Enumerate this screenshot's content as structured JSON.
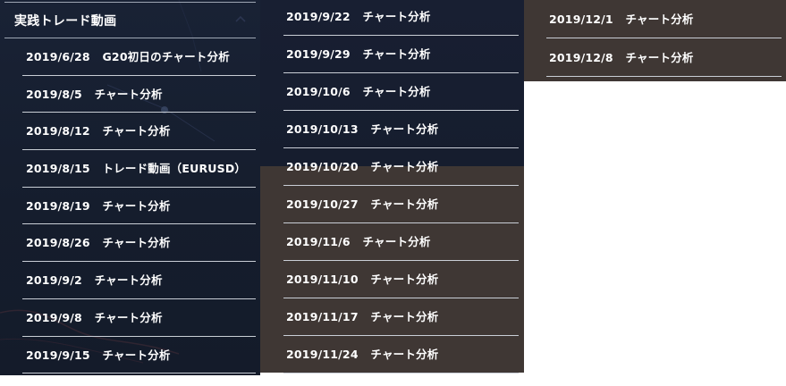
{
  "menu": {
    "title": "実践トレード動画",
    "caret_icon": "chevron-up-icon"
  },
  "columns": [
    {
      "items": [
        {
          "label": "2019/6/28   G20初日のチャート分析"
        },
        {
          "label": "2019/8/5   チャート分析"
        },
        {
          "label": "2019/8/12   チャート分析"
        },
        {
          "label": "2019/8/15   トレード動画（EURUSD）"
        },
        {
          "label": "2019/8/19   チャート分析"
        },
        {
          "label": "2019/8/26   チャート分析"
        },
        {
          "label": "2019/9/2   チャート分析"
        },
        {
          "label": "2019/9/8   チャート分析"
        },
        {
          "label": "2019/9/15   チャート分析"
        }
      ]
    },
    {
      "items": [
        {
          "label": "2019/9/22   チャート分析"
        },
        {
          "label": "2019/9/29   チャート分析"
        },
        {
          "label": "2019/10/6   チャート分析"
        },
        {
          "label": "2019/10/13   チャート分析"
        },
        {
          "label": "2019/10/20   チャート分析"
        },
        {
          "label": "2019/10/27   チャート分析"
        },
        {
          "label": "2019/11/6   チャート分析"
        },
        {
          "label": "2019/11/10   チャート分析"
        },
        {
          "label": "2019/11/17   チャート分析"
        },
        {
          "label": "2019/11/24   チャート分析"
        }
      ]
    },
    {
      "items": [
        {
          "label": "2019/12/1   チャート分析"
        },
        {
          "label": "2019/12/8   チャート分析"
        }
      ]
    }
  ],
  "colors": {
    "navy_panel": "#172033",
    "brown_panel": "#3f3734",
    "divider": "#c9ced6",
    "text": "#ffffff"
  }
}
